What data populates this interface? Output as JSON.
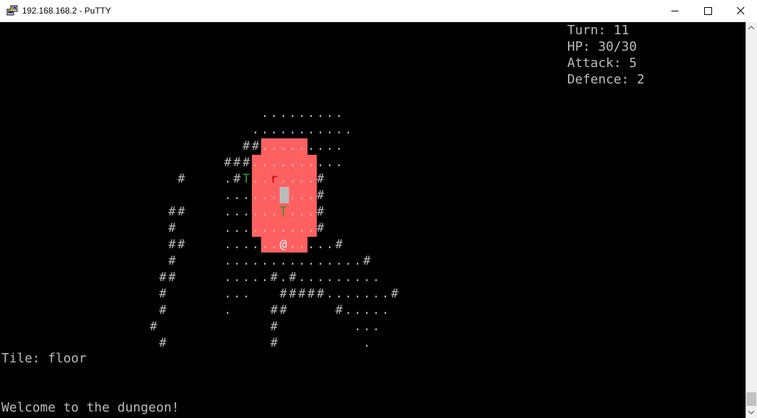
{
  "window": {
    "title": "192.168.168.2 - PuTTY"
  },
  "stats": {
    "turn": "Turn: 11",
    "hp": "HP: 30/30",
    "attack": "Attack: 5",
    "defence": "Defence: 2"
  },
  "status": {
    "tile": "Tile: floor",
    "message": "Welcome to the dungeon!"
  },
  "colors": {
    "highlight": "#ff6060",
    "tree": "#2e9a2e",
    "rat": "#c00000",
    "text": "#bbbbbb",
    "player": "#ffffff"
  },
  "map": {
    "player": "@",
    "rat": "r",
    "tree": "T",
    "rows": [
      "                            .........",
      "                           ...........",
      "                          ##.........",
      "                        ###..........",
      "                   #    .#T..r....#",
      "                        ..........#",
      "                  ##    ......T...#",
      "                  #     ..........#",
      "                  ##    ......@.....#",
      "                  #     ...............#",
      "                 ##     .....#.#.........",
      "                 #      ...   #####.......#",
      "                 #      .    ##     #.....",
      "                #            #        ...",
      "                 #           #         ."
    ]
  }
}
